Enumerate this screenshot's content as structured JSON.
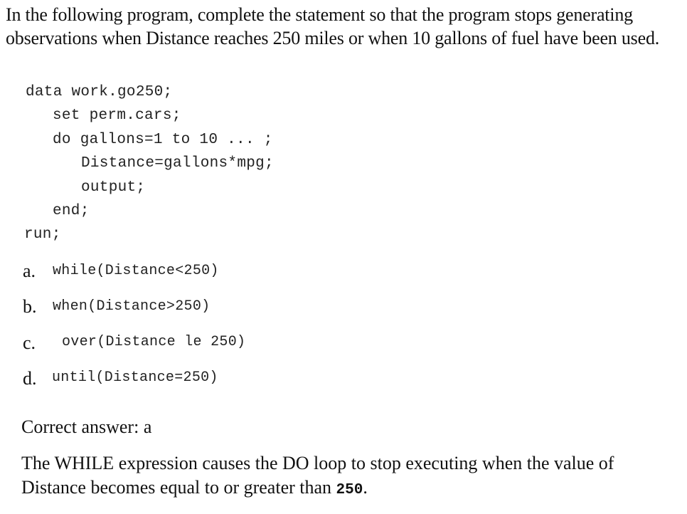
{
  "question": {
    "text": "In the following program, complete the statement so that the program stops generating observations when Distance reaches 250 miles or when 10 gallons of fuel have been used."
  },
  "code": {
    "lines": [
      "data work.go250;",
      "set perm.cars;",
      "do gallons=1 to 10 ... ;",
      "Distance=gallons*mpg;",
      "output;",
      "end;",
      "run;"
    ]
  },
  "options": [
    {
      "letter": "a.",
      "code": "while(Distance<250)"
    },
    {
      "letter": "b.",
      "code": "when(Distance>250)"
    },
    {
      "letter": "c.",
      "code": "over(Distance le 250)"
    },
    {
      "letter": "d.",
      "code": "until(Distance=250)"
    }
  ],
  "answer": {
    "text": "Correct answer: a"
  },
  "explanation": {
    "text": "The WHILE expression causes the DO loop to stop executing when the value of Distance becomes equal to or greater than",
    "value": "250",
    "end": "."
  }
}
